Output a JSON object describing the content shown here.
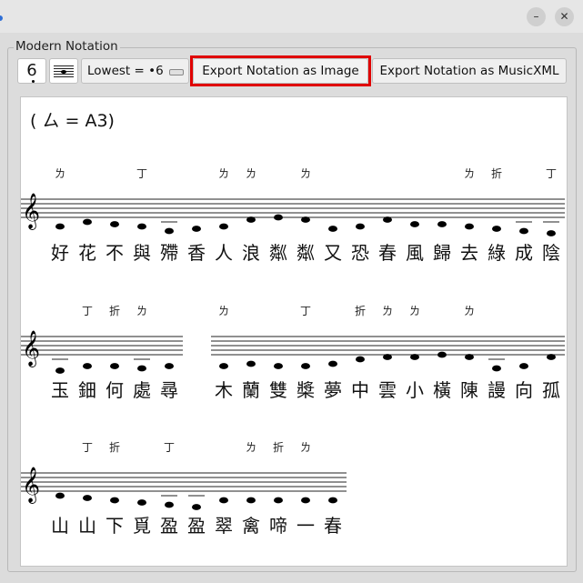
{
  "window": {
    "minimize_glyph": "–",
    "close_glyph": "✕"
  },
  "panel": {
    "title": "Modern Notation"
  },
  "toolbar": {
    "number_button": "6",
    "lowest_select": "Lowest = •6",
    "export_image": "Export Notation as Image",
    "export_xml": "Export Notation as MusicXML"
  },
  "notation": {
    "key_label": "( ㄙ = A3)",
    "clef_glyph": "𝄞",
    "lines": [
      {
        "segments": [
          {
            "chars": [
              "好",
              "花",
              "不",
              "與",
              "殢",
              "香",
              "人",
              "浪",
              "粼",
              "粼",
              "又",
              "恐",
              "春",
              "風",
              "歸",
              "去",
              "綠",
              "成",
              "陰"
            ],
            "marks": [
              "ㄌ",
              "",
              "",
              "丁",
              "",
              "",
              "ㄌ",
              "ㄌ",
              "",
              "ㄌ",
              "",
              "",
              "",
              "",
              "",
              "ㄌ",
              "折",
              "",
              "丁"
            ],
            "notes": [
              -2,
              -1,
              -1.5,
              -2,
              -3,
              -2.5,
              -2,
              -0.5,
              0,
              -0.5,
              -2.5,
              -2,
              -0.5,
              -1.5,
              -1.5,
              -2,
              -2.5,
              -3,
              -3.5
            ]
          }
        ]
      },
      {
        "segments": [
          {
            "chars": [
              "玉",
              "鈿",
              "何",
              "處",
              "尋"
            ],
            "marks": [
              "",
              "丁",
              "折",
              "ㄌ",
              ""
            ],
            "notes": [
              -3.5,
              -2.5,
              -2.5,
              -3,
              -2.5
            ]
          },
          {
            "chars": [
              "木",
              "蘭",
              "雙",
              "槳",
              "夢",
              "中",
              "雲",
              "小",
              "橫",
              "陳",
              "謾",
              "向",
              "孤"
            ],
            "marks": [
              "ㄌ",
              "",
              "",
              "丁",
              "",
              "折",
              "ㄌ",
              "ㄌ",
              "",
              "ㄌ",
              "",
              "",
              ""
            ],
            "notes": [
              -2.5,
              -2,
              -2.5,
              -2.5,
              -2,
              -1,
              -0.5,
              -0.5,
              0,
              -0.5,
              -3,
              -2.5,
              -0.5
            ]
          }
        ]
      },
      {
        "segments": [
          {
            "chars": [
              "山",
              "山",
              "下",
              "覓",
              "盈",
              "盈",
              "翠",
              "禽",
              "啼",
              "一",
              "春"
            ],
            "marks": [
              "",
              "丁",
              "折",
              "",
              "丁",
              "",
              "",
              "ㄌ",
              "折",
              "ㄌ",
              ""
            ],
            "notes": [
              -1,
              -1.5,
              -2,
              -2.5,
              -3,
              -3.5,
              -2,
              -2,
              -2,
              -2,
              -2
            ]
          }
        ]
      }
    ]
  }
}
